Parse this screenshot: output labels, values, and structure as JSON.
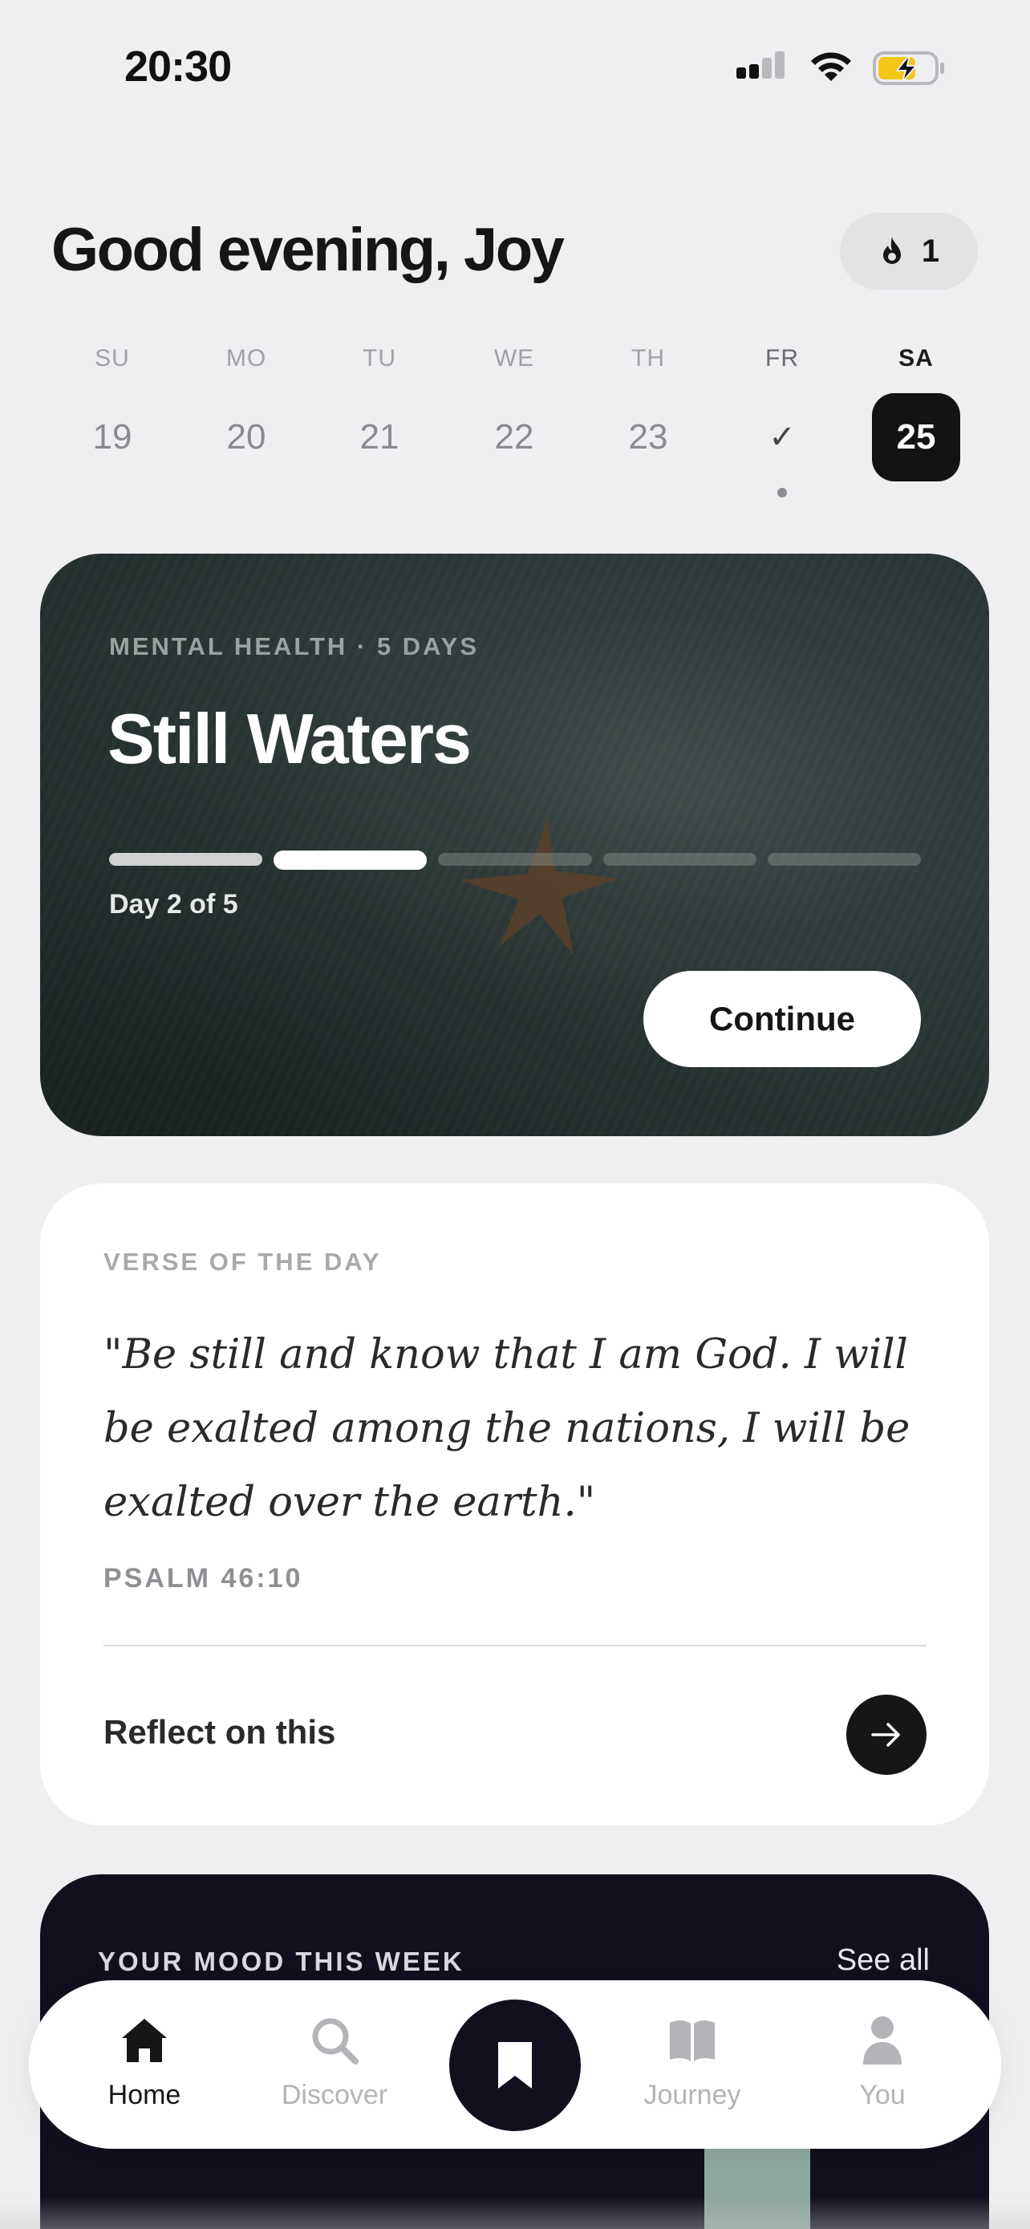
{
  "status_bar": {
    "time": "20:30"
  },
  "header": {
    "greeting": "Good evening, Joy",
    "streak_count": "1"
  },
  "week": {
    "days": [
      {
        "label": "SU",
        "value": "19",
        "state": "normal"
      },
      {
        "label": "MO",
        "value": "20",
        "state": "normal"
      },
      {
        "label": "TU",
        "value": "21",
        "state": "normal"
      },
      {
        "label": "WE",
        "value": "22",
        "state": "normal"
      },
      {
        "label": "TH",
        "value": "23",
        "state": "normal"
      },
      {
        "label": "FR",
        "value": "✓",
        "state": "done"
      },
      {
        "label": "SA",
        "value": "25",
        "state": "active"
      }
    ]
  },
  "plan": {
    "kicker": "MENTAL HEALTH · 5 DAYS",
    "title": "Still Waters",
    "progress_text": "Day 2 of 5",
    "current_day": 2,
    "total_days": 5,
    "continue_label": "Continue"
  },
  "verse": {
    "kicker": "VERSE OF THE DAY",
    "text": "\"Be still and know that I am God. I will be exalted among the nations, I will be exalted over the earth.\"",
    "reference": "PSALM 46:10",
    "reflect_label": "Reflect on this"
  },
  "mood": {
    "kicker": "YOUR MOOD THIS WEEK",
    "see_all": "See all"
  },
  "nav": {
    "items": [
      {
        "label": "Home",
        "icon": "home-icon",
        "active": true
      },
      {
        "label": "Discover",
        "icon": "search-icon",
        "active": false
      },
      {
        "label": "",
        "icon": "bookmark-icon",
        "active": false
      },
      {
        "label": "Journey",
        "icon": "book-icon",
        "active": false
      },
      {
        "label": "You",
        "icon": "person-icon",
        "active": false
      }
    ]
  },
  "colors": {
    "accent_dark": "#10101e",
    "plan_bg": "#2d3938",
    "mood_bar": "#8ea79d"
  }
}
